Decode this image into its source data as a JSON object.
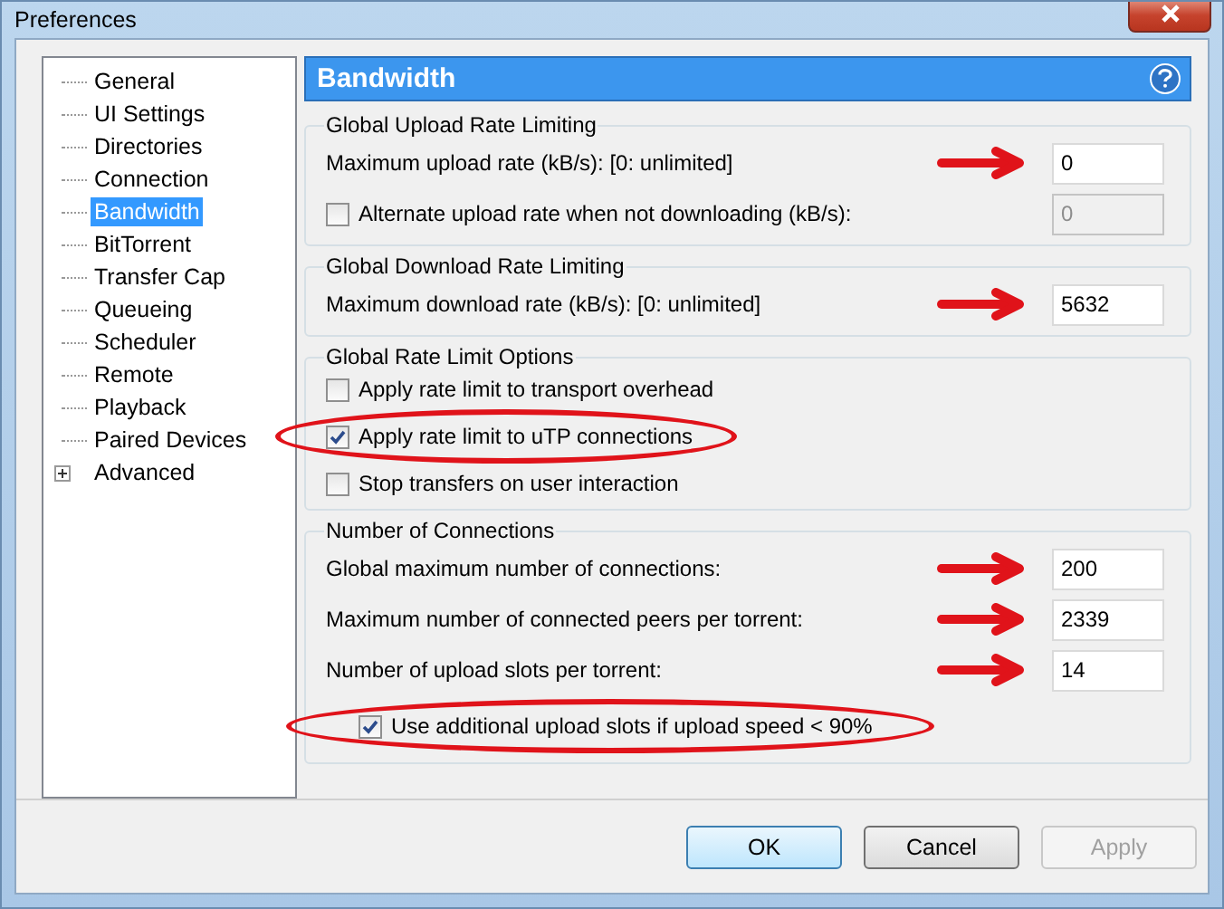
{
  "window": {
    "title": "Preferences"
  },
  "sidebar": {
    "items": [
      {
        "label": "General",
        "selected": false
      },
      {
        "label": "UI Settings",
        "selected": false
      },
      {
        "label": "Directories",
        "selected": false
      },
      {
        "label": "Connection",
        "selected": false
      },
      {
        "label": "Bandwidth",
        "selected": true
      },
      {
        "label": "BitTorrent",
        "selected": false
      },
      {
        "label": "Transfer Cap",
        "selected": false
      },
      {
        "label": "Queueing",
        "selected": false
      },
      {
        "label": "Scheduler",
        "selected": false
      },
      {
        "label": "Remote",
        "selected": false
      },
      {
        "label": "Playback",
        "selected": false
      },
      {
        "label": "Paired Devices",
        "selected": false
      },
      {
        "label": "Advanced",
        "selected": false,
        "expanded": false
      }
    ]
  },
  "panel": {
    "title": "Bandwidth"
  },
  "groups": [
    {
      "title": "Global Upload Rate Limiting",
      "rows": [
        {
          "kind": "field",
          "label": "Maximum upload rate (kB/s): [0: unlimited]",
          "value": "0",
          "disabled": false,
          "arrow_marked": true
        },
        {
          "kind": "checkfield",
          "label": "Alternate upload rate when not downloading (kB/s):",
          "checked": false,
          "value": "0",
          "disabled": true
        }
      ]
    },
    {
      "title": "Global Download Rate Limiting",
      "rows": [
        {
          "kind": "field",
          "label": "Maximum download rate (kB/s): [0: unlimited]",
          "value": "5632",
          "disabled": false,
          "arrow_marked": true
        }
      ]
    },
    {
      "title": "Global Rate Limit Options",
      "rows": [
        {
          "kind": "checkbox",
          "label": "Apply rate limit to transport overhead",
          "checked": false,
          "circled": false
        },
        {
          "kind": "checkbox",
          "label": "Apply rate limit to uTP connections",
          "checked": true,
          "circled": true
        },
        {
          "kind": "checkbox",
          "label": "Stop transfers on user interaction",
          "checked": false,
          "circled": false
        }
      ]
    },
    {
      "title": "Number of Connections",
      "rows": [
        {
          "kind": "field",
          "label": "Global maximum number of connections:",
          "value": "200",
          "disabled": false,
          "arrow_marked": true
        },
        {
          "kind": "field",
          "label": "Maximum number of connected peers per torrent:",
          "value": "2339",
          "disabled": false,
          "arrow_marked": true
        },
        {
          "kind": "field",
          "label": "Number of upload slots per torrent:",
          "value": "14",
          "disabled": false,
          "arrow_marked": true
        },
        {
          "kind": "subcheckbox",
          "label": "Use additional upload slots if upload speed < 90%",
          "checked": true,
          "circled": true
        }
      ]
    }
  ],
  "buttons": [
    {
      "label": "OK",
      "kind": "default",
      "disabled": false
    },
    {
      "label": "Cancel",
      "kind": "normal",
      "disabled": false
    },
    {
      "label": "Apply",
      "kind": "normal",
      "disabled": true
    }
  ]
}
